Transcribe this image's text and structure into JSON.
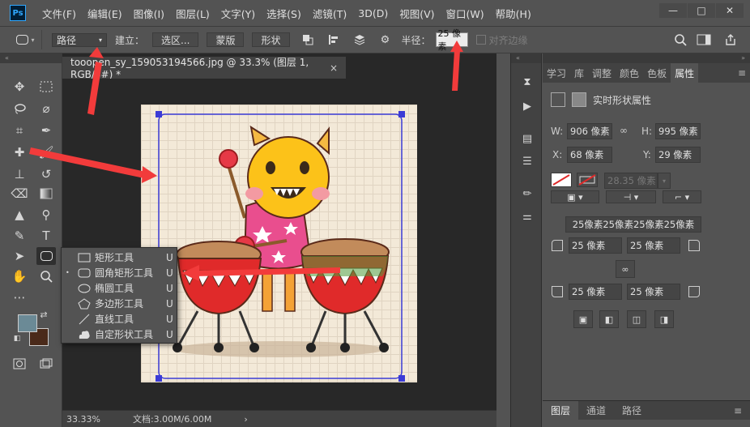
{
  "app": {
    "logo": "Ps",
    "menu": [
      "文件(F)",
      "编辑(E)",
      "图像(I)",
      "图层(L)",
      "文字(Y)",
      "选择(S)",
      "滤镜(T)",
      "3D(D)",
      "视图(V)",
      "窗口(W)",
      "帮助(H)"
    ],
    "window_controls": [
      "—",
      "□",
      "✕"
    ]
  },
  "options_bar": {
    "mode_value": "路径",
    "create_label": "建立：",
    "selection_button": "选区...",
    "mask_button": "蒙版",
    "shape_button": "形状",
    "radius_label": "半径：",
    "radius_value": "25 像素",
    "align_edges_label": "对齐边缘"
  },
  "document": {
    "tab_title": "tooopen_sy_159053194566.jpg @ 33.3% (图层 1, RGB/8#) *",
    "tab_close": "×",
    "zoom": "33.33%",
    "doc_size": "文档:3.00M/6.00M",
    "status_arrow": "›"
  },
  "colors": {
    "foreground": "#6b8a96",
    "background": "#4a2a1a",
    "path_outline": "#3b3bd6",
    "annotation_arrow": "#f23b3b"
  },
  "shape_flyout": {
    "items": [
      {
        "label": "矩形工具",
        "key": "U",
        "icon": "rectangle-icon",
        "selected": false
      },
      {
        "label": "圆角矩形工具",
        "key": "U",
        "icon": "rounded-rectangle-icon",
        "selected": true
      },
      {
        "label": "椭圆工具",
        "key": "U",
        "icon": "ellipse-icon",
        "selected": false
      },
      {
        "label": "多边形工具",
        "key": "U",
        "icon": "polygon-icon",
        "selected": false
      },
      {
        "label": "直线工具",
        "key": "U",
        "icon": "line-icon",
        "selected": false
      },
      {
        "label": "自定形状工具",
        "key": "U",
        "icon": "custom-shape-icon",
        "selected": false
      }
    ],
    "selected_bullet": "•"
  },
  "right_panel": {
    "tabs": [
      "学习",
      "库",
      "调整",
      "颜色",
      "色板",
      "属性"
    ],
    "active_tab": "属性",
    "header": "实时形状属性",
    "w_label": "W:",
    "w_value": "906 像素",
    "h_label": "H:",
    "h_value": "995 像素",
    "x_label": "X:",
    "x_value": "68 像素",
    "y_label": "Y:",
    "y_value": "29 像素",
    "stroke_width": "28.35 像素",
    "corner_all": "25像素25像素25像素25像素",
    "corner_tl": "25 像素",
    "corner_tr": "25 像素",
    "corner_bl": "25 像素",
    "corner_br": "25 像素",
    "bottom_tabs": [
      "图层",
      "通道",
      "路径"
    ],
    "active_bottom_tab": "图层"
  }
}
